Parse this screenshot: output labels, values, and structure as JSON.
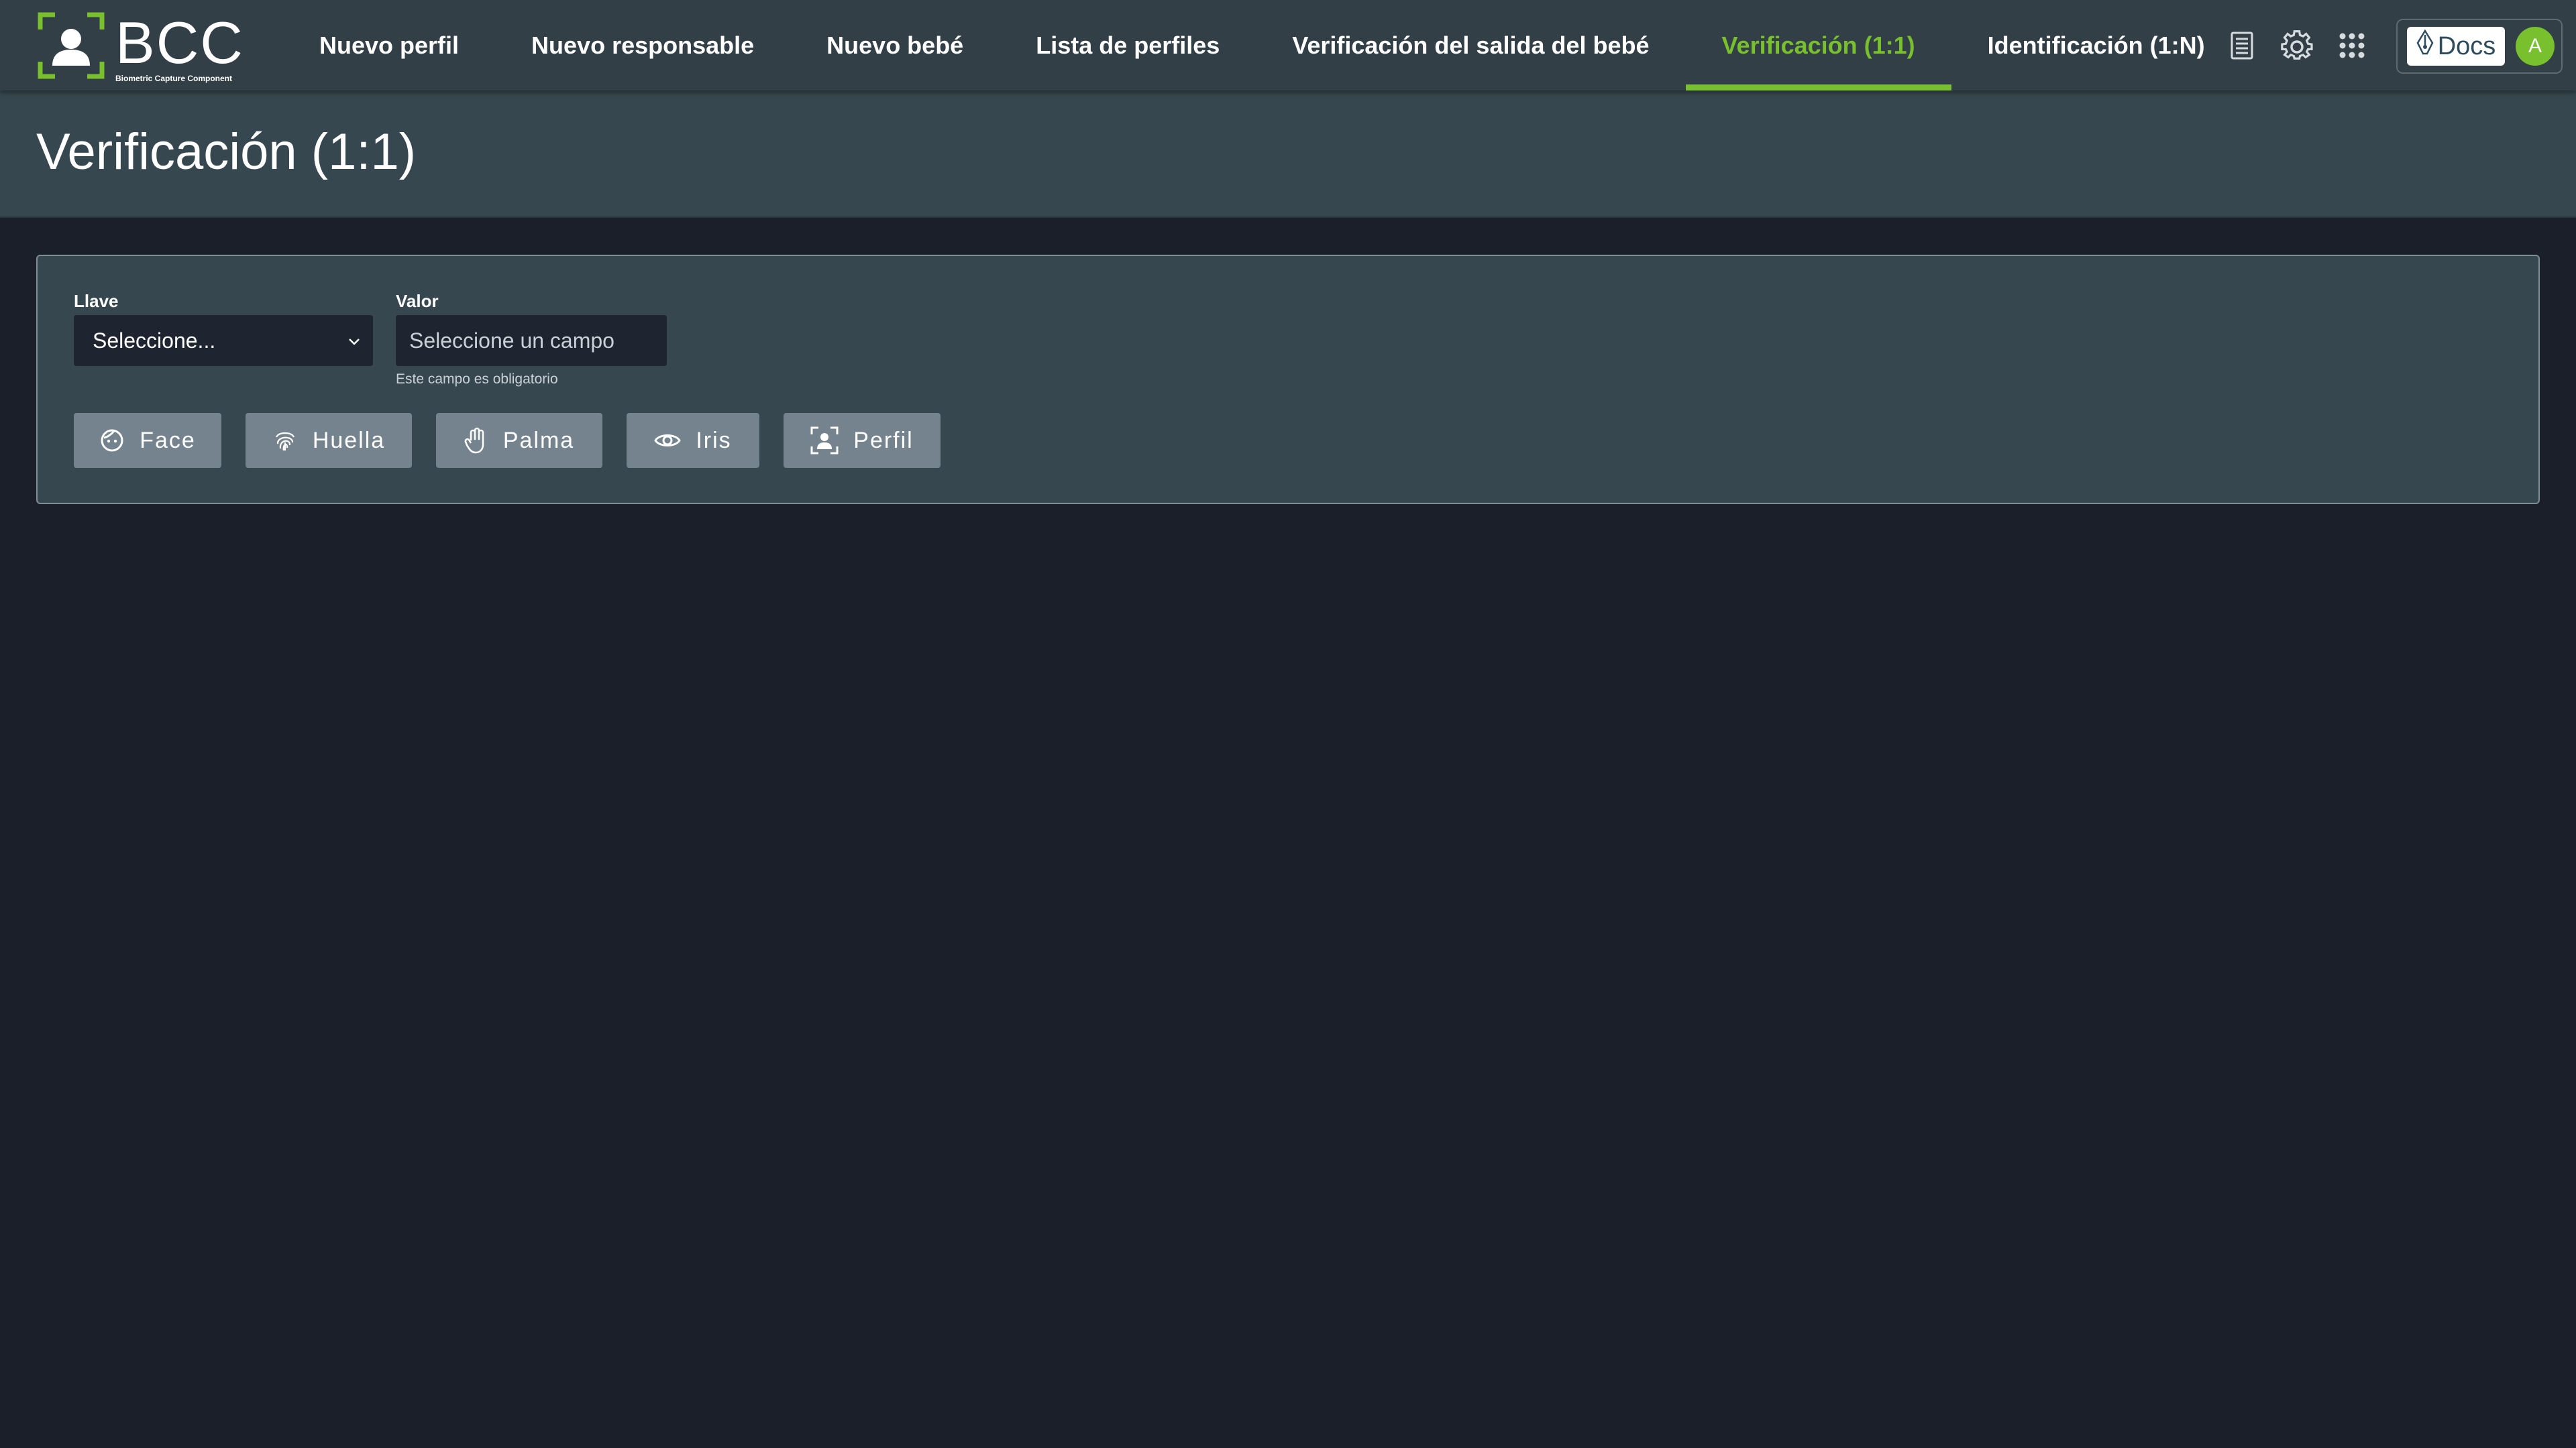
{
  "app": {
    "logo_title": "BCC",
    "logo_subtitle": "Biometric Capture Component",
    "brand_color": "#78c02e"
  },
  "nav": {
    "items": [
      {
        "label": "Nuevo perfil",
        "active": false
      },
      {
        "label": "Nuevo responsable",
        "active": false
      },
      {
        "label": "Nuevo bebé",
        "active": false
      },
      {
        "label": "Lista de perfiles",
        "active": false
      },
      {
        "label": "Verificación del salida del bebé",
        "active": false
      },
      {
        "label": "Verificación (1:1)",
        "active": true
      },
      {
        "label": "Identificación (1:N)",
        "active": false
      }
    ],
    "icons": [
      "document-icon",
      "gear-icon",
      "apps-grid-icon"
    ],
    "docs_label": "Docs",
    "avatar_initial": "A"
  },
  "page": {
    "title": "Verificación (1:1)"
  },
  "form": {
    "key_label": "Llave",
    "key_selected": "Seleccione...",
    "value_label": "Valor",
    "value_placeholder": "Seleccione un campo",
    "value_current": "",
    "required_help": "Este campo es obligatorio"
  },
  "buttons": [
    {
      "label": "Face",
      "icon": "face-icon"
    },
    {
      "label": "Huella",
      "icon": "fingerprint-icon"
    },
    {
      "label": "Palma",
      "icon": "palm-icon"
    },
    {
      "label": "Iris",
      "icon": "eye-icon"
    },
    {
      "label": "Perfil",
      "icon": "profile-scan-icon"
    }
  ]
}
